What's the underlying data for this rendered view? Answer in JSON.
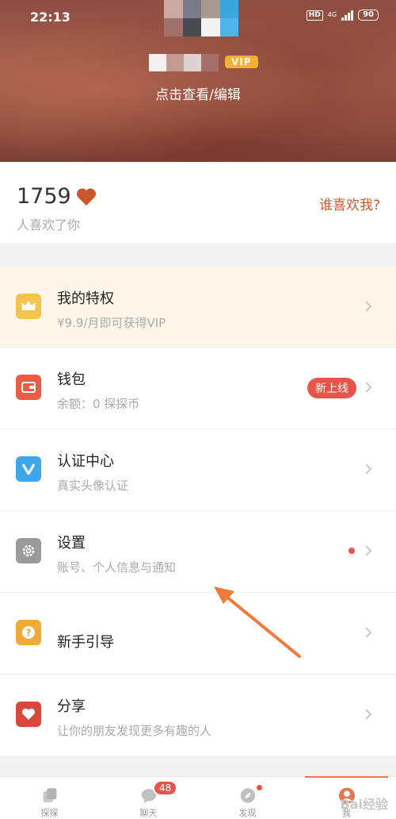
{
  "status_bar": {
    "time": "22:13",
    "hd": "HD",
    "network": "4G",
    "battery": "90"
  },
  "profile": {
    "vip_label": "VIP",
    "view_edit": "点击查看/编辑"
  },
  "likes": {
    "count": "1759",
    "subtitle": "人喜欢了你",
    "who_likes_link": "谁喜欢我?"
  },
  "menu": {
    "items": [
      {
        "title": "我的特权",
        "subtitle": "¥9.9/月即可获得VIP",
        "icon": "crown-icon",
        "color": "#f5c44f"
      },
      {
        "title": "钱包",
        "subtitle": "余额：0 探探币",
        "icon": "wallet-icon",
        "color": "#ea5c44",
        "badge": "新上线"
      },
      {
        "title": "认证中心",
        "subtitle": "真实头像认证",
        "icon": "verify-icon",
        "color": "#3fa7e7"
      },
      {
        "title": "设置",
        "subtitle": "账号、个人信息与通知",
        "icon": "gear-icon",
        "color": "#9a9a9a"
      },
      {
        "title": "新手引导",
        "icon": "help-icon",
        "color": "#f1a938"
      },
      {
        "title": "分享",
        "subtitle": "让你的朋友发现更多有趣的人",
        "icon": "heart-icon",
        "color": "#d9483b"
      }
    ]
  },
  "bottom_nav": {
    "items": [
      {
        "label": "探探",
        "icon": "cards-icon"
      },
      {
        "label": "聊天",
        "icon": "chat-icon",
        "badge": "48"
      },
      {
        "label": "发现",
        "icon": "compass-icon"
      },
      {
        "label": "我",
        "icon": "profile-icon"
      }
    ],
    "watermark": "Bai经验"
  },
  "colors": {
    "accent": "#e07a52",
    "badge_red": "#e8534a",
    "link": "#c45c30",
    "privilege_bg": "#fdf6e9"
  }
}
